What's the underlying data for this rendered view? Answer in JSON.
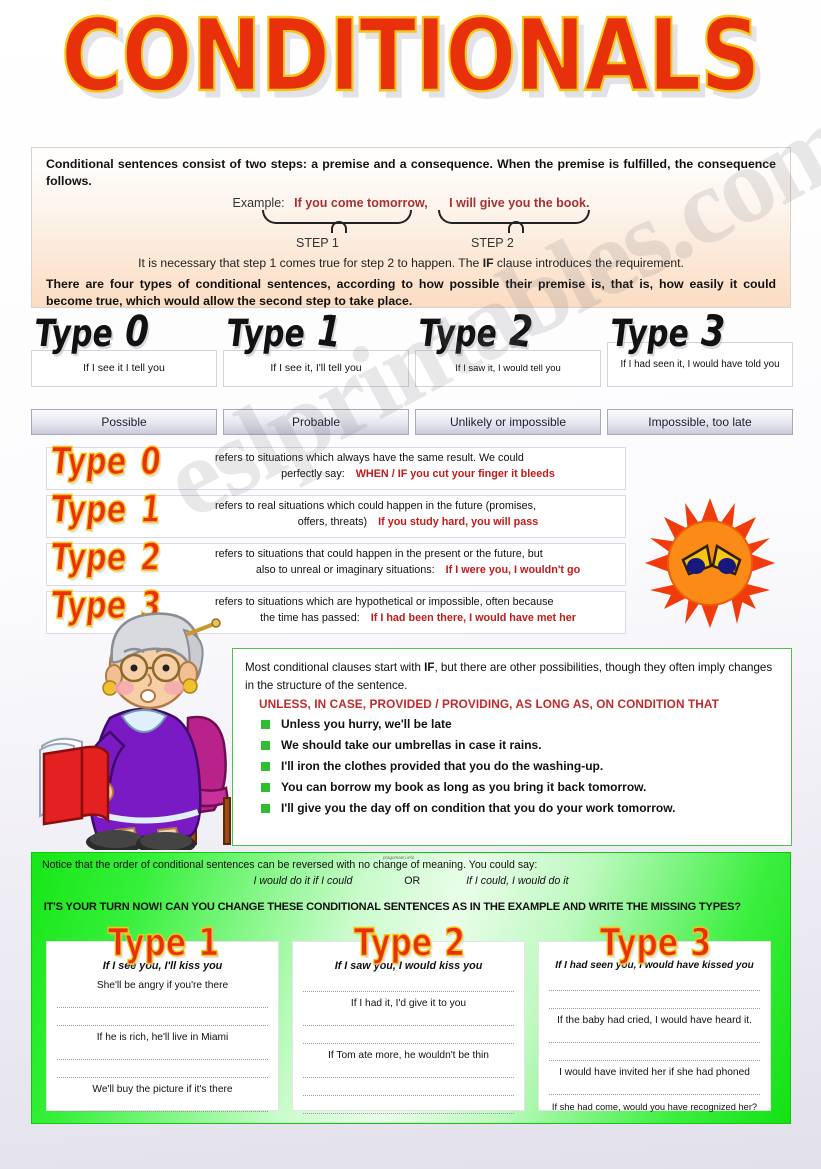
{
  "title": "CONDITIONALS",
  "watermark": "eslprintables.com",
  "credit": "pragomann.info",
  "intro": {
    "line1": "Conditional sentences consist of two steps: a premise and a consequence. When the premise is fulfilled, the consequence follows.",
    "example_label": "Example:",
    "example_step1": "If you come tomorrow,",
    "example_step2": "I will give you the book.",
    "step1_label": "STEP 1",
    "step2_label": "STEP 2",
    "note_a": "It is necessary that step 1 comes true for step 2 to happen. The ",
    "note_if": "IF",
    "note_b": " clause introduces the requirement.",
    "line2": "There are four types of conditional sentences, according to how possible their premise is, that is, how easily it could become true, which would allow the second step to take place."
  },
  "types": [
    {
      "word": "Type",
      "num": "0",
      "example": "If I see it I tell you",
      "chance": "Possible"
    },
    {
      "word": "Type",
      "num": "1",
      "example": "If I see it, I'll tell you",
      "chance": "Probable"
    },
    {
      "word": "Type",
      "num": "2",
      "example": "If I saw it, I would tell you",
      "chance": "Unlikely or impossible"
    },
    {
      "word": "Type",
      "num": "3",
      "example": "If I had seen it, I would have told you",
      "chance": "Impossible, too late"
    }
  ],
  "explanations": [
    {
      "word": "Type",
      "num": "0",
      "line1": "refers to situations which always have the same result. We could",
      "line2_pre": "perfectly say:",
      "line2_example": "WHEN / IF you cut your finger it bleeds"
    },
    {
      "word": "Type",
      "num": "1",
      "line1": "refers to real situations which could happen in the future (promises,",
      "line2_pre": "offers, threats)",
      "line2_example": "If you study hard, you will pass"
    },
    {
      "word": "Type",
      "num": "2",
      "line1": "refers to situations that could happen in the present or the future, but",
      "line2_pre": "also to unreal or imaginary situations:",
      "line2_example": "If I were you, I wouldn't go"
    },
    {
      "word": "Type",
      "num": "3",
      "line1": "refers to situations which are hypothetical or impossible, often because",
      "line2_pre": "the time has passed:",
      "line2_example": "If I had been there, I would have met her"
    }
  ],
  "unless": {
    "lead_a": "Most conditional clauses start with ",
    "lead_if": "IF",
    "lead_b": ", but there are other possibilities, though they often imply changes in the structure of the sentence.",
    "keywords": "UNLESS, IN CASE, PROVIDED / PROVIDING, AS LONG AS, ON CONDITION THAT",
    "items": [
      "Unless you hurry, we'll be late",
      "We should take our umbrellas in case it rains.",
      "I'll iron the clothes provided that you do the washing-up.",
      "You can borrow my book as long as you bring it back tomorrow.",
      "I'll give you the day off on condition that you do your work tomorrow."
    ]
  },
  "green": {
    "notice": "Notice that the order of conditional sentences can be reversed with no change of meaning. You could say:",
    "reversed_a": "I would do it if I could",
    "or": "OR",
    "reversed_b": "If I could, I would do it",
    "task": "IT'S YOUR TURN NOW! CAN YOU CHANGE THESE CONDITIONAL SENTENCES AS IN THE EXAMPLE AND WRITE THE MISSING TYPES?"
  },
  "exercises": [
    {
      "word": "Type",
      "num": "1",
      "model": "If I see you, I'll kiss you",
      "lines": [
        {
          "kind": "text",
          "value": "She'll be angry if you're there"
        },
        {
          "kind": "blank",
          "value": ""
        },
        {
          "kind": "blank",
          "value": ""
        },
        {
          "kind": "text",
          "value": "If he is rich, he'll live in Miami"
        },
        {
          "kind": "blank",
          "value": ""
        },
        {
          "kind": "blank",
          "value": ""
        },
        {
          "kind": "text",
          "value": "We'll buy the picture if it's there"
        },
        {
          "kind": "blank",
          "value": ""
        }
      ]
    },
    {
      "word": "Type",
      "num": "2",
      "model": "If I saw you, I would kiss you",
      "lines": [
        {
          "kind": "blank",
          "value": ""
        },
        {
          "kind": "text",
          "value": "If I had it, I'd give it to you"
        },
        {
          "kind": "blank",
          "value": ""
        },
        {
          "kind": "blank",
          "value": ""
        },
        {
          "kind": "text",
          "value": "If Tom ate more, he wouldn't be thin"
        },
        {
          "kind": "blank",
          "value": ""
        },
        {
          "kind": "blank",
          "value": ""
        },
        {
          "kind": "blank",
          "value": ""
        }
      ]
    },
    {
      "word": "Type",
      "num": "3",
      "model": "If I had seen you, I would have kissed you",
      "lines": [
        {
          "kind": "blank",
          "value": ""
        },
        {
          "kind": "blank",
          "value": ""
        },
        {
          "kind": "text",
          "value": "If the baby had cried, I would have heard it."
        },
        {
          "kind": "blank",
          "value": ""
        },
        {
          "kind": "blank",
          "value": ""
        },
        {
          "kind": "text",
          "value": "I would have invited her if she had phoned"
        },
        {
          "kind": "blank",
          "value": ""
        },
        {
          "kind": "text",
          "value": "If she had come, would you have recognized her?"
        }
      ]
    }
  ],
  "colors": {
    "title_red": "#e8310a",
    "title_outline": "#f5c518",
    "example_red": "#a83232",
    "keyword_red": "#c22a2a",
    "green_border": "#4ec44e",
    "green_bg": "#2fe32f",
    "bullet_green": "#2fbe2f"
  }
}
